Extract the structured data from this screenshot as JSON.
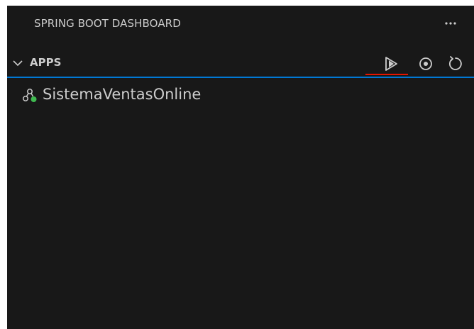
{
  "view": {
    "title": "SPRING BOOT DASHBOARD",
    "more_icon": "ellipsis-icon"
  },
  "section": {
    "title": "APPS",
    "expanded": true,
    "actions": [
      {
        "icon": "run-icon",
        "label": "Run"
      },
      {
        "icon": "stop-icon",
        "label": "Stop"
      },
      {
        "icon": "restart-icon",
        "label": "Restart"
      }
    ]
  },
  "apps": [
    {
      "name": "SistemaVentasOnline",
      "icon": "spring-app-icon",
      "status": "running",
      "status_color": "#3fb950"
    }
  ],
  "colors": {
    "background": "#181818",
    "text": "#cccccc",
    "focus_border": "#0078d4",
    "run_underline": "#e51400",
    "status_running": "#3fb950"
  }
}
